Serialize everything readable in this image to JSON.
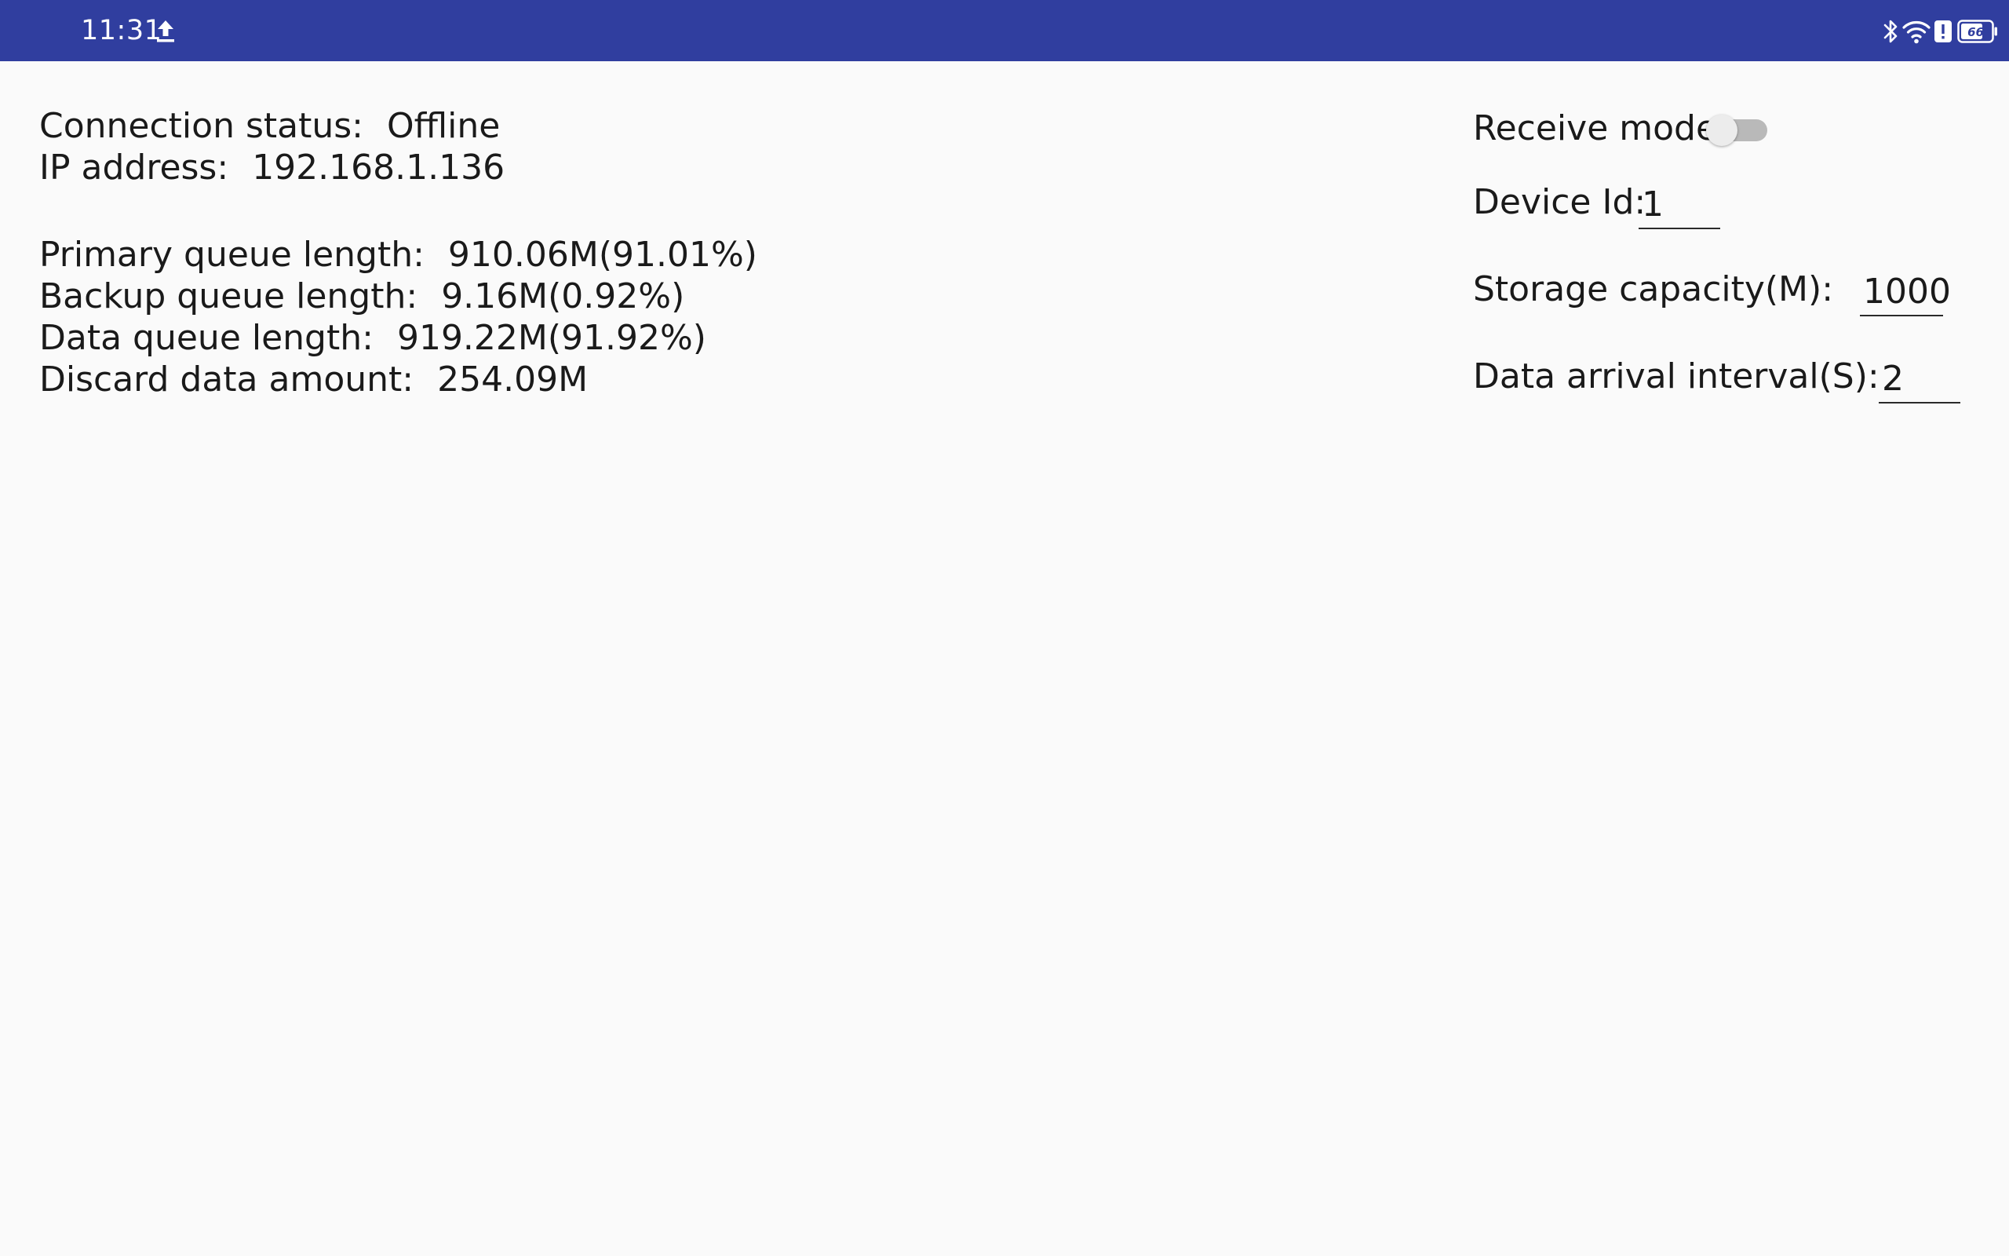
{
  "status_bar": {
    "time": "11:31",
    "icons": [
      "upload-icon",
      "bluetooth-icon",
      "wifi-icon",
      "alert-icon",
      "battery-icon"
    ],
    "battery_level": "66",
    "background_color": "#303e9f"
  },
  "info": {
    "connection_status_label": "Connection status:",
    "connection_status_value": "Offline",
    "ip_address_label": "IP address:",
    "ip_address_value": "192.168.1.136",
    "primary_queue_label": "Primary queue length:",
    "primary_queue_value": "910.06M(91.01%)",
    "backup_queue_label": "Backup queue length:",
    "backup_queue_value": "9.16M(0.92%)",
    "data_queue_label": "Data queue length:",
    "data_queue_value": "919.22M(91.92%)",
    "discard_label": "Discard data amount:",
    "discard_value": "254.09M"
  },
  "settings": {
    "receive_mode_label": "Receive mode",
    "receive_mode_on": false,
    "device_id_label": "Device Id:",
    "device_id_value": "1",
    "storage_capacity_label": "Storage capacity(M):",
    "storage_capacity_value": "1000",
    "data_arrival_interval_label": "Data arrival interval(S):",
    "data_arrival_interval_value": "2"
  }
}
